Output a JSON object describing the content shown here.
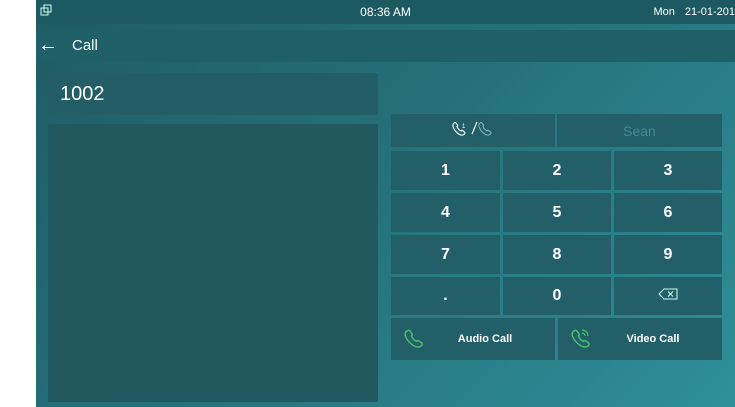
{
  "status": {
    "time": "08:36 AM",
    "day": "Mon",
    "date": "21-01-201"
  },
  "title": "Call",
  "dial": {
    "number": "1002"
  },
  "contact": {
    "name": "Sean"
  },
  "keypad": [
    "1",
    "2",
    "3",
    "4",
    "5",
    "6",
    "7",
    "8",
    "9",
    ".",
    "0"
  ],
  "buttons": {
    "audio_call": "Audio Call",
    "video_call": "Video Call"
  },
  "colors": {
    "accent_green": "#4cc46a",
    "muted_text": "#3f8e96"
  },
  "icons": {
    "device": "device-icon",
    "back": "back-arrow-icon",
    "mode": "audio-video-toggle-icon",
    "backspace": "backspace-icon",
    "audio": "phone-icon",
    "video": "video-phone-icon"
  }
}
